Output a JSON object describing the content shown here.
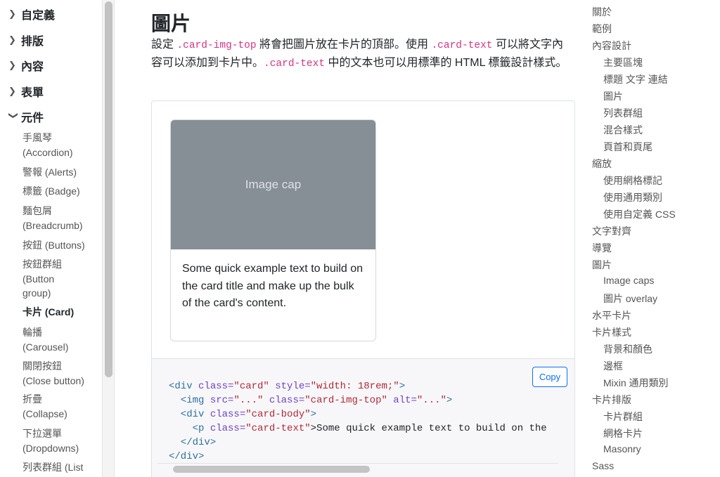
{
  "sidebar": {
    "sections": [
      {
        "label": "自定義",
        "expanded": false
      },
      {
        "label": "排版",
        "expanded": false
      },
      {
        "label": "內容",
        "expanded": false
      },
      {
        "label": "表單",
        "expanded": false
      },
      {
        "label": "元件",
        "expanded": true
      }
    ],
    "components": [
      {
        "line1": "手風琴",
        "line2": "(Accordion)"
      },
      {
        "line1": "警報 (Alerts)"
      },
      {
        "line1": "標籤 (Badge)"
      },
      {
        "line1": "麵包屑",
        "line2": "(Breadcrumb)"
      },
      {
        "line1": "按鈕 (Buttons)"
      },
      {
        "line1": "按鈕群組",
        "line2": "(Button",
        "line3": "group)"
      },
      {
        "line1": "卡片 (Card)",
        "active": true
      },
      {
        "line1": "輪播",
        "line2": "(Carousel)"
      },
      {
        "line1": "關閉按鈕",
        "line2": "(Close button)"
      },
      {
        "line1": "折疊",
        "line2": "(Collapse)"
      },
      {
        "line1": "下拉選單",
        "line2": "(Dropdowns)"
      },
      {
        "line1": "列表群組 (List"
      }
    ]
  },
  "main": {
    "title": "圖片",
    "desc": {
      "p1": "設定 ",
      "c1": ".card-img-top",
      "p2": " 將會把圖片放在卡片的頂部。使用 ",
      "c2": ".card-text",
      "p3": " 可以將文字內容可以添加到卡片中。",
      "c3": ".card-text",
      "p4": " 中的文本也可以用標準的 HTML 標籤設計樣式。"
    },
    "card": {
      "image_cap": "Image cap",
      "text": "Some quick example text to build on the card title and make up the bulk of the card's content."
    },
    "copy_label": "Copy",
    "code": {
      "l1": [
        "<div",
        " class=",
        "\"card\"",
        " style=",
        "\"width: 18rem;\"",
        ">"
      ],
      "l2": [
        "  <img",
        " src=",
        "\"...\"",
        " class=",
        "\"card-img-top\"",
        " alt=",
        "\"...\"",
        ">"
      ],
      "l3": [
        "  <div",
        " class=",
        "\"card-body\"",
        ">"
      ],
      "l4": [
        "    <p",
        " class=",
        "\"card-text\"",
        ">Some quick example text to build on the"
      ],
      "l5": [
        "  </div>"
      ],
      "l6": [
        "</div>"
      ]
    }
  },
  "toc": {
    "items": [
      {
        "label": "關於",
        "level": 1
      },
      {
        "label": "範例",
        "level": 1
      },
      {
        "label": "內容設計",
        "level": 1
      },
      {
        "label": "主要區塊",
        "level": 2
      },
      {
        "label": "標題 文字 連結",
        "level": 2
      },
      {
        "label": "圖片",
        "level": 2
      },
      {
        "label": "列表群組",
        "level": 2
      },
      {
        "label": "混合樣式",
        "level": 2
      },
      {
        "label": "頁首和頁尾",
        "level": 2
      },
      {
        "label": "縮放",
        "level": 1
      },
      {
        "label": "使用網格標記",
        "level": 2
      },
      {
        "label": "使用通用類別",
        "level": 2
      },
      {
        "label": "使用自定義 CSS",
        "level": 2
      },
      {
        "label": "文字對齊",
        "level": 1
      },
      {
        "label": "導覽",
        "level": 1
      },
      {
        "label": "圖片",
        "level": 1
      },
      {
        "label": "Image caps",
        "level": 2
      },
      {
        "label": "圖片 overlay",
        "level": 2
      },
      {
        "label": "水平卡片",
        "level": 1
      },
      {
        "label": "卡片樣式",
        "level": 1
      },
      {
        "label": "背景和顏色",
        "level": 2
      },
      {
        "label": "邊框",
        "level": 2
      },
      {
        "label": "Mixin 通用類別",
        "level": 2
      },
      {
        "label": "卡片排版",
        "level": 1
      },
      {
        "label": "卡片群組",
        "level": 2
      },
      {
        "label": "網格卡片",
        "level": 2
      },
      {
        "label": "Masonry",
        "level": 2
      },
      {
        "label": "Sass",
        "level": 1
      }
    ]
  }
}
